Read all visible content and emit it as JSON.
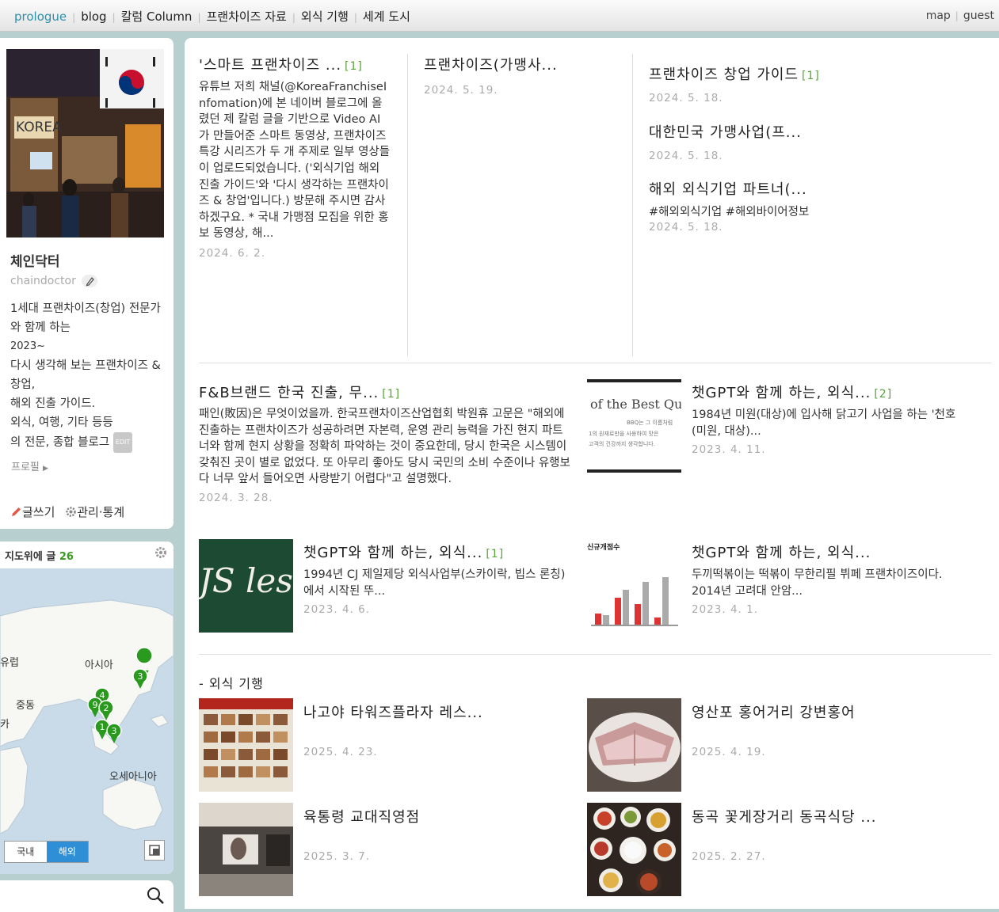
{
  "nav": {
    "items": [
      "prologue",
      "blog",
      "칼럼 Column",
      "프랜차이즈 자료",
      "외식 기행",
      "세계 도시"
    ],
    "right": [
      "map",
      "guest"
    ]
  },
  "profile": {
    "name": "체인닥터",
    "id": "chaindoctor",
    "intro": [
      "1세대 프랜차이즈(창업) 전문가와 함께 하는",
      "2023~",
      "다시 생각해 보는 프랜차이즈 & 창업,",
      "해외 진출 가이드.",
      "외식, 여행, 기타 등등",
      "의  전문, 종합 블로그"
    ],
    "edit_badge": "EDIT",
    "profile_link": "프로필",
    "write": "글쓰기",
    "manage": "관리·통계"
  },
  "map": {
    "header": "지도위에 글",
    "count": "26",
    "labels": {
      "europe": "유럽",
      "asia": "아시아",
      "mideast": "중동",
      "africa": "카",
      "oceania": "오세아니아"
    },
    "pins": [
      "5",
      "3",
      "4",
      "9",
      "2",
      "1",
      "3"
    ],
    "tab_domestic": "국내",
    "tab_overseas": "해외"
  },
  "posts_top": [
    {
      "title": "'스마트 프랜차이즈 ...",
      "comments": "[1]",
      "excerpt": "유튜브 저희 채널(@KoreaFranchiseInfomation)에 본 네이버 블로그에 올렸던 제 칼럼 글을 기반으로 Video AI가 만들어준 스마트 동영상, 프랜차이즈 특강 시리즈가 두 개 주제로 일부 영상들이 업로드되었습니다. ('외식기업 해외 진출 가이드'와 '다시 생각하는 프랜차이즈 & 창업'입니다.) 방문해 주시면 감사하겠구요. * 국내 가맹점 모집을 위한 홍보 동영상, 해...",
      "date": "2024. 6. 2."
    },
    {
      "title": "프랜차이즈(가맹사...",
      "date": "2024. 5. 19."
    }
  ],
  "posts_side": [
    {
      "title": "프랜차이즈 창업 가이드",
      "comments": "[1]",
      "date": "2024. 5. 18."
    },
    {
      "title": "대한민국 가맹사업(프...",
      "date": "2024. 5. 18."
    },
    {
      "title": "해외 외식기업 파트너(...",
      "tags": "#해외외식기업 #해외바이어정보",
      "date": "2024. 5. 18."
    }
  ],
  "posts_mid": [
    {
      "title": "F&B브랜드 한국 진출, 무...",
      "comments": "[1]",
      "excerpt": "패인(敗因)은 무엇이었을까. 한국프랜차이즈산업협회 박원휴 고문은 \"해외에 진출하는 프랜차이즈가 성공하려면 자본력, 운영 관리 능력을 가진 현지 파트너와 함께 현지 상황을 정확히 파악하는 것이 중요한데, 당시 한국은 시스템이 갖춰진 곳이 별로 없었다. 또 아무리 좋아도 당시 국민의 소비 수준이나 유행보다 너무 앞서 들어오면 사랑받기 어렵다\"고 설명했다.",
      "date": "2024. 3. 28."
    },
    {
      "title": "챗GPT와 함께 하는, 외식...",
      "comments": "[2]",
      "excerpt": "1984년 미원(대상)에 입사해 닭고기 사업을 하는 '천호(미원, 대상)...",
      "date": "2023. 4. 11.",
      "thumb_text": [
        "of the Best Qu",
        "BBQ는 그 이름처럼",
        "1의 원재료만을 사용하여 맛은",
        "고객의 건강까지 생각합니다."
      ]
    },
    {
      "title": "챗GPT와 함께 하는, 외식...",
      "comments": "[1]",
      "excerpt": "1994년 CJ 제일제당 외식사업부(스카이락, 빕스 론칭)에서 시작된 뚜...",
      "date": "2023. 4. 6.",
      "thumb_text": "JS les J"
    },
    {
      "title": "챗GPT와 함께 하는, 외식...",
      "excerpt": "두끼떡볶이는 떡볶이 무한리필 뷔페 프랜차이즈이다. 2014년 고려대 안암...",
      "date": "2023. 4. 1.",
      "thumb_text": "신규개점수"
    }
  ],
  "section": {
    "title": "- 외식 기행",
    "posts": [
      {
        "title": "나고야 타워즈플라자 레스...",
        "date": "2025. 4. 23."
      },
      {
        "title": "영산포 홍어거리 강변홍어",
        "date": "2025. 4. 19."
      },
      {
        "title": "육통령 교대직영점",
        "date": "2025. 3. 7."
      },
      {
        "title": "동곡 꽃게장거리 동곡식당 ...",
        "date": "2025. 2. 27."
      }
    ]
  }
}
